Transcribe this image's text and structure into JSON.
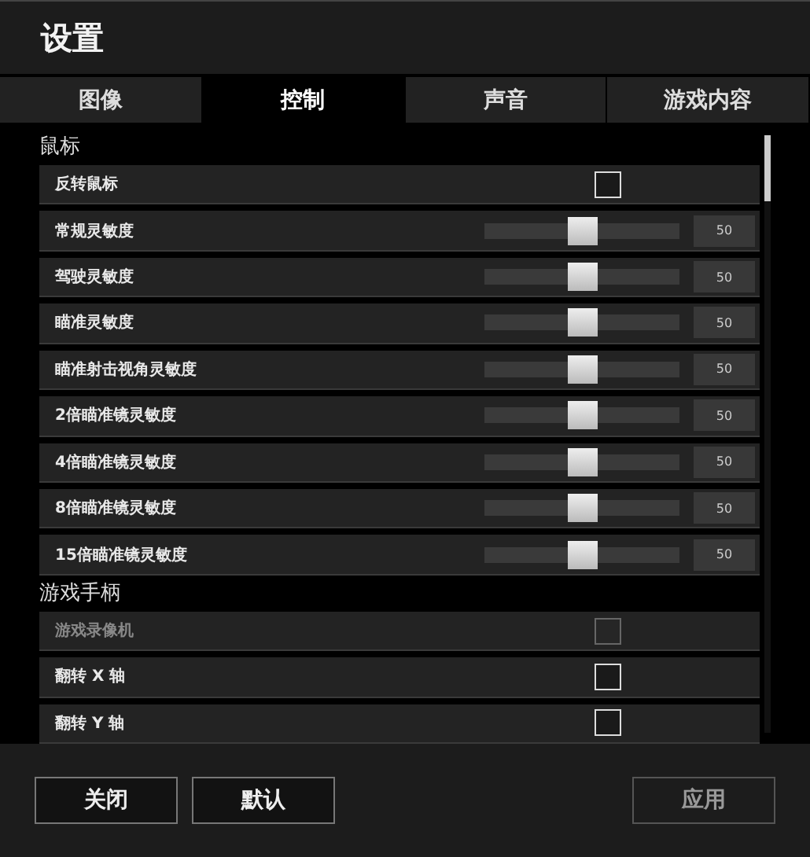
{
  "window": {
    "title": "设置"
  },
  "tabs": [
    {
      "label": "图像",
      "selected": false
    },
    {
      "label": "控制",
      "selected": true
    },
    {
      "label": "声音",
      "selected": false
    },
    {
      "label": "游戏内容",
      "selected": false
    }
  ],
  "sections": [
    {
      "title": "鼠标",
      "rows": [
        {
          "kind": "checkbox",
          "label": "反转鼠标",
          "checked": false,
          "disabled": false
        },
        {
          "kind": "slider",
          "label": "常规灵敏度",
          "level": 0.5,
          "reading": "50"
        },
        {
          "kind": "slider",
          "label": "驾驶灵敏度",
          "level": 0.5,
          "reading": "50"
        },
        {
          "kind": "slider",
          "label": "瞄准灵敏度",
          "level": 0.5,
          "reading": "50"
        },
        {
          "kind": "slider",
          "label": "瞄准射击视角灵敏度",
          "level": 0.5,
          "reading": "50"
        },
        {
          "kind": "slider",
          "label": "2倍瞄准镜灵敏度",
          "level": 0.5,
          "reading": "50"
        },
        {
          "kind": "slider",
          "label": "4倍瞄准镜灵敏度",
          "level": 0.5,
          "reading": "50"
        },
        {
          "kind": "slider",
          "label": "8倍瞄准镜灵敏度",
          "level": 0.5,
          "reading": "50"
        },
        {
          "kind": "slider",
          "label": "15倍瞄准镜灵敏度",
          "level": 0.5,
          "reading": "50"
        }
      ]
    },
    {
      "title": "游戏手柄",
      "rows": [
        {
          "kind": "checkbox",
          "label": "游戏录像机",
          "checked": false,
          "disabled": true
        },
        {
          "kind": "checkbox",
          "label": "翻转 X 轴",
          "checked": false,
          "disabled": false
        },
        {
          "kind": "checkbox",
          "label": "翻转 Y 轴",
          "checked": false,
          "disabled": false
        }
      ]
    }
  ],
  "buttons": [
    {
      "label": "关闭",
      "disabled": false
    },
    {
      "label": "默认",
      "disabled": false
    },
    {
      "label": "应用",
      "disabled": true
    }
  ]
}
